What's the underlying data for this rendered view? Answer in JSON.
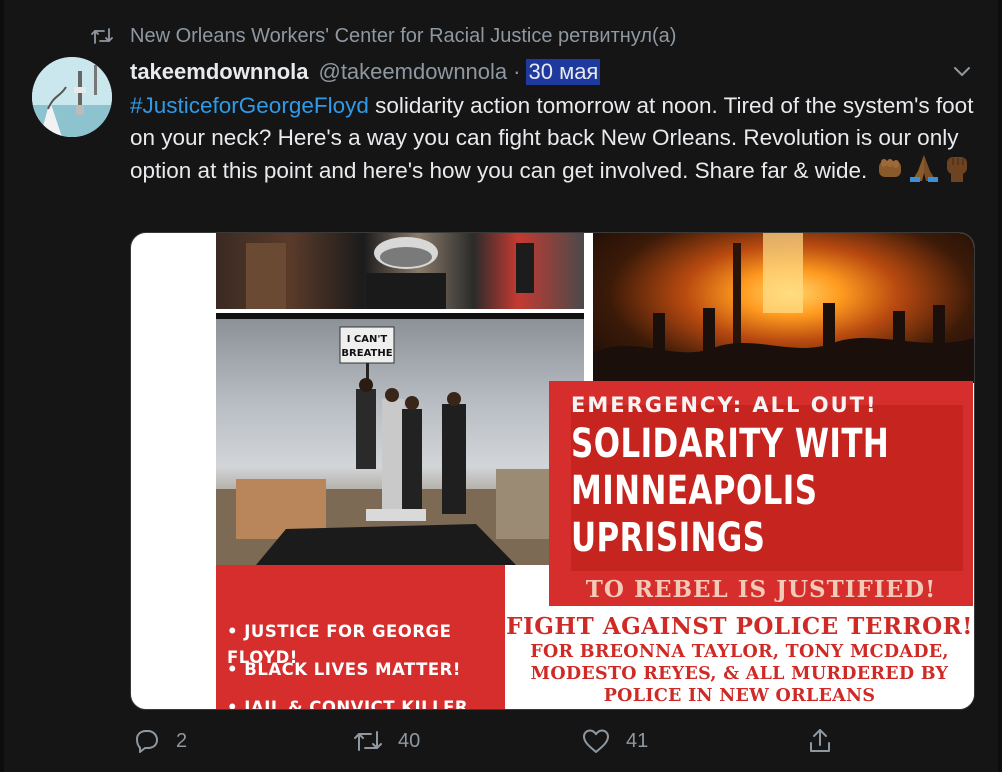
{
  "retweet": {
    "text": "New Orleans Workers' Center for Racial Justice ретвитнул(а)"
  },
  "tweet": {
    "author_name": "takeemdownnola",
    "author_handle": "@takeemdownnola",
    "separator": "·",
    "date": "30 мая",
    "hashtag": "#JusticeforGeorgeFloyd",
    "text": " solidarity action tomorrow at noon. Tired of the system's foot on your neck? Here's a way you can fight back New Orleans. Revolution is our only option at this point and here's how you can get involved. Share far & wide. ",
    "emojis": [
      "fist-emoji",
      "folded-hands-emoji",
      "raised-fist-emoji"
    ]
  },
  "media": {
    "sign_text_1": "I CAN'T",
    "sign_text_2": "BREATHE",
    "emergency": "EMERGENCY: ALL OUT!",
    "headline_1": "SOLIDARITY WITH",
    "headline_2": "MINNEAPOLIS",
    "headline_3": "UPRISINGS",
    "rebel": "TO REBEL IS JUSTIFIED!",
    "bullets": [
      "• JUSTICE FOR GEORGE FLOYD!",
      "• BLACK LIVES MATTER!",
      "• JAIL & CONVICT KILLER"
    ],
    "fight_1": "FIGHT AGAINST POLICE TERROR!",
    "fight_2": "FOR BREONNA TAYLOR, TONY MCDADE,",
    "fight_3": "MODESTO REYES, & ALL MURDERED BY",
    "fight_4": "POLICE IN NEW ORLEANS"
  },
  "actions": {
    "reply_count": "2",
    "retweet_count": "40",
    "like_count": "41"
  },
  "colors": {
    "background": "#151515",
    "accent_blue": "#2f9be8",
    "date_highlight": "#1e3a9e",
    "muted": "#8f98a0",
    "poster_red": "#d62e2c"
  }
}
